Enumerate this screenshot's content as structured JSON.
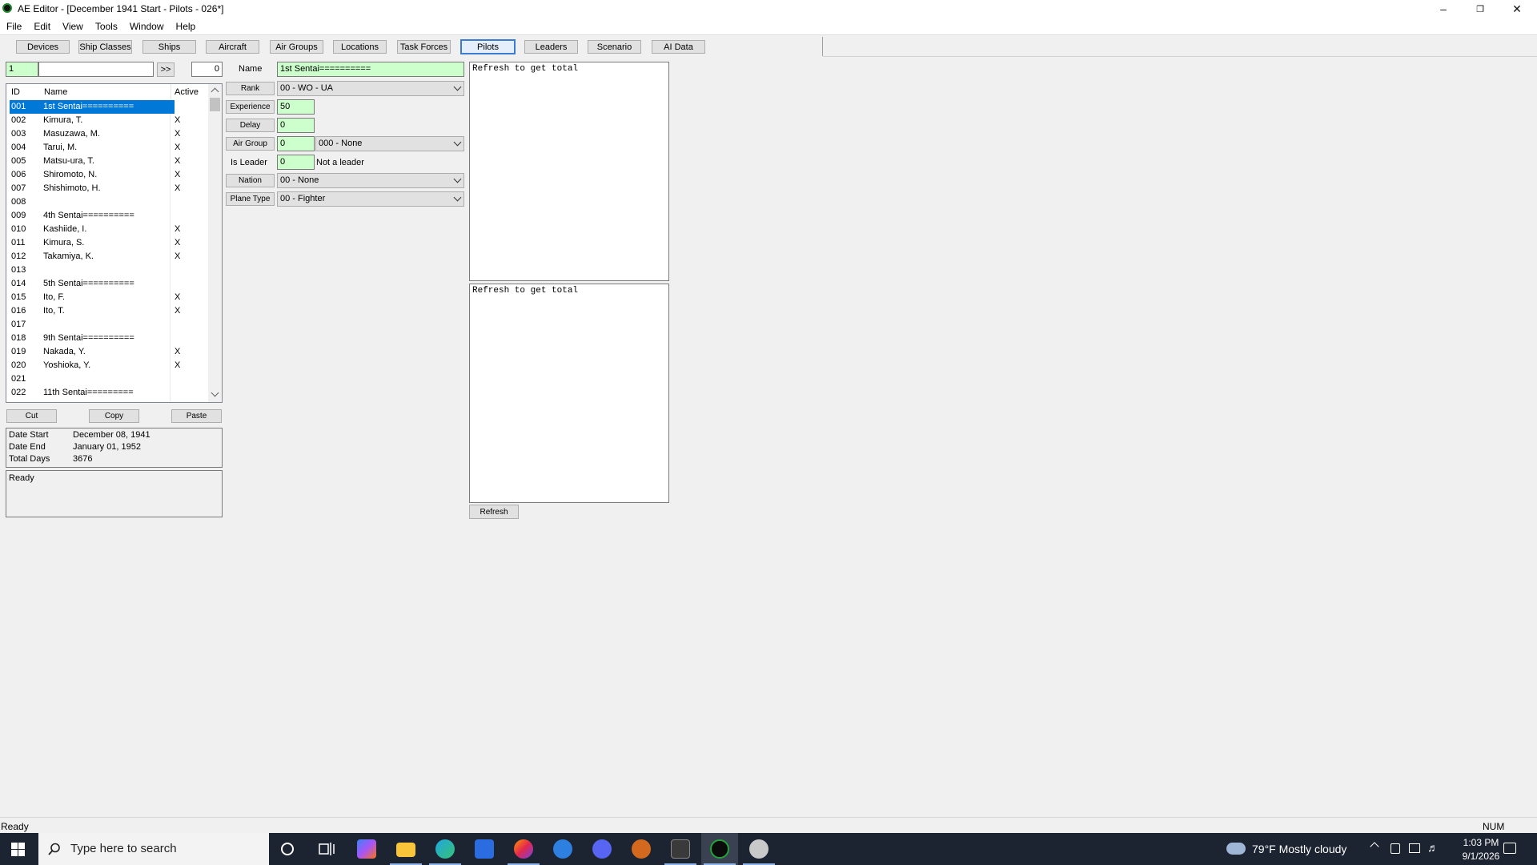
{
  "window": {
    "title": "AE Editor - [December 1941 Start - Pilots - 026*]",
    "controls": [
      "–",
      "❐",
      "✕"
    ]
  },
  "menu": [
    "File",
    "Edit",
    "View",
    "Tools",
    "Window",
    "Help"
  ],
  "toolbar": {
    "tabs": [
      "Devices",
      "Ship Classes",
      "Ships",
      "Aircraft",
      "Air Groups",
      "Locations",
      "Task Forces",
      "Pilots",
      "Leaders",
      "Scenario",
      "AI Data"
    ],
    "active": "Pilots"
  },
  "search": {
    "id_value": "1",
    "text_value": "",
    "go_label": ">>",
    "count_value": "0"
  },
  "list": {
    "headers": [
      "ID",
      "Name",
      "Active"
    ],
    "rows": [
      {
        "id": "001",
        "name": "1st Sentai==========",
        "active": ""
      },
      {
        "id": "002",
        "name": "Kimura, T.",
        "active": "X"
      },
      {
        "id": "003",
        "name": "Masuzawa, M.",
        "active": "X"
      },
      {
        "id": "004",
        "name": "Tarui, M.",
        "active": "X"
      },
      {
        "id": "005",
        "name": "Matsu-ura, T.",
        "active": "X"
      },
      {
        "id": "006",
        "name": "Shiromoto, N.",
        "active": "X"
      },
      {
        "id": "007",
        "name": "Shishimoto, H.",
        "active": "X"
      },
      {
        "id": "008",
        "name": "",
        "active": ""
      },
      {
        "id": "009",
        "name": "4th Sentai==========",
        "active": ""
      },
      {
        "id": "010",
        "name": "Kashiide, I.",
        "active": "X"
      },
      {
        "id": "011",
        "name": "Kimura, S.",
        "active": "X"
      },
      {
        "id": "012",
        "name": "Takamiya, K.",
        "active": "X"
      },
      {
        "id": "013",
        "name": "",
        "active": ""
      },
      {
        "id": "014",
        "name": "5th Sentai==========",
        "active": ""
      },
      {
        "id": "015",
        "name": "Ito, F.",
        "active": "X"
      },
      {
        "id": "016",
        "name": "Ito, T.",
        "active": "X"
      },
      {
        "id": "017",
        "name": "",
        "active": ""
      },
      {
        "id": "018",
        "name": "9th Sentai==========",
        "active": ""
      },
      {
        "id": "019",
        "name": "Nakada, Y.",
        "active": "X"
      },
      {
        "id": "020",
        "name": "Yoshioka, Y.",
        "active": "X"
      },
      {
        "id": "021",
        "name": "",
        "active": ""
      },
      {
        "id": "022",
        "name": "11th Sentai=========",
        "active": ""
      }
    ]
  },
  "clipboard": {
    "cut": "Cut",
    "copy": "Copy",
    "paste": "Paste"
  },
  "dates": {
    "start_label": "Date Start",
    "start_value": "December 08, 1941",
    "end_label": "Date End",
    "end_value": "January 01, 1952",
    "days_label": "Total Days",
    "days_value": "3676"
  },
  "log": "Ready",
  "form": {
    "name_label": "Name",
    "name_value": "1st Sentai==========",
    "rank_label": "Rank",
    "rank_value": "00 - WO - UA",
    "experience_label": "Experience",
    "experience_value": "50",
    "delay_label": "Delay",
    "delay_value": "0",
    "airgroup_label": "Air Group",
    "airgroup_value": "0",
    "airgroup_select": "000 - None",
    "leader_label": "Is Leader",
    "leader_value": "0",
    "leader_text": "Not a leader",
    "nation_label": "Nation",
    "nation_value": "00 - None",
    "planetype_label": "Plane Type",
    "planetype_value": "00 - Fighter"
  },
  "totals": {
    "top_text": "Refresh to get total",
    "bottom_text": "Refresh to get total",
    "refresh_label": "Refresh"
  },
  "statusbar": {
    "left": "Ready",
    "right": "NUM"
  },
  "taskbar": {
    "search_placeholder": "Type here to search",
    "weather": "79°F  Mostly cloudy",
    "time": "1:03 PM",
    "date": "9/1/2026"
  }
}
